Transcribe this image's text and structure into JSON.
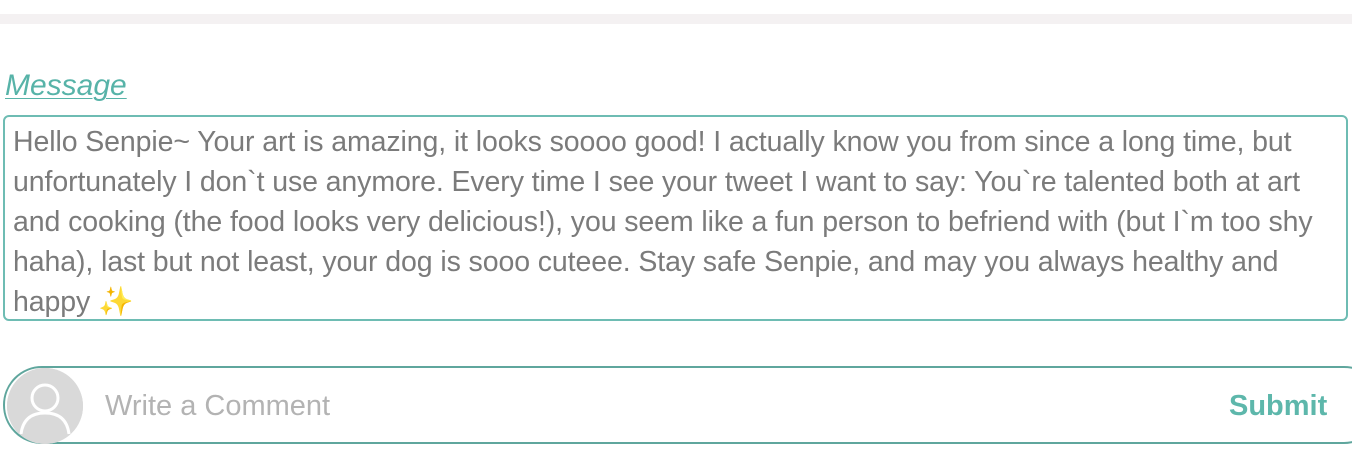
{
  "message_section": {
    "label": "Message",
    "text": "Hello Senpie~ Your art is amazing, it looks soooo good! I actually know you from since a long time, but unfortunately I don`t use anymore. Every time I see your tweet I want to say: You`re talented both at art and cooking (the food looks very delicious!), you seem like a fun person to befriend with (but I`m too shy haha), last but not least, your dog is sooo cuteee. Stay safe Senpie, and may you always healthy and happy",
    "emoji": "✨"
  },
  "comment": {
    "placeholder": "Write a Comment",
    "submit_label": "Submit",
    "avatar_icon": "user-placeholder-icon"
  },
  "colors": {
    "accent": "#57b3a8",
    "border": "#6ebcb3",
    "text": "#7b7b7b",
    "placeholder": "#b3b3b3"
  }
}
